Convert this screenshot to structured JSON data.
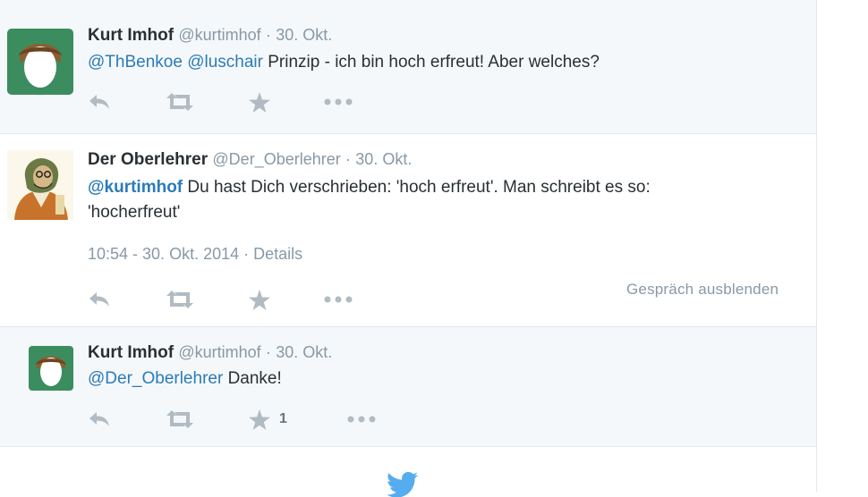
{
  "colors": {
    "link": "#2b7bb9",
    "muted": "#8899a6",
    "icon": "#b1bbc3",
    "bg_light": "#f5f8fa"
  },
  "tweets": [
    {
      "name": "Kurt Imhof",
      "handle": "@kurtimhof",
      "dot": "·",
      "date": "30. Okt.",
      "mention1": "@ThBenkoe",
      "mention2": "@luschair",
      "body": " Prinzip - ich bin hoch erfreut! Aber welches?",
      "actions": {
        "reply": "reply-icon",
        "retweet": "retweet-icon",
        "favorite": "star-icon",
        "more": "more-icon"
      }
    },
    {
      "name": "Der Oberlehrer",
      "handle": "@Der_Oberlehrer",
      "dot": "·",
      "date": "30. Okt.",
      "mention": "@kurtimhof",
      "body_line1": " Du hast Dich verschrieben: 'hoch erfreut'. Man schreibt es so:",
      "body_line2": "'hocherfreut'",
      "timestamp": "10:54 - 30. Okt. 2014",
      "details": "Details",
      "hide_conversation": "Gespräch ausblenden"
    },
    {
      "name": "Kurt Imhof",
      "handle": "@kurtimhof",
      "dot": "·",
      "date": "30. Okt.",
      "mention": "@Der_Oberlehrer",
      "body": " Danke!",
      "favorite_count": "1"
    }
  ],
  "footer": {
    "icon": "twitter-bird-icon"
  }
}
